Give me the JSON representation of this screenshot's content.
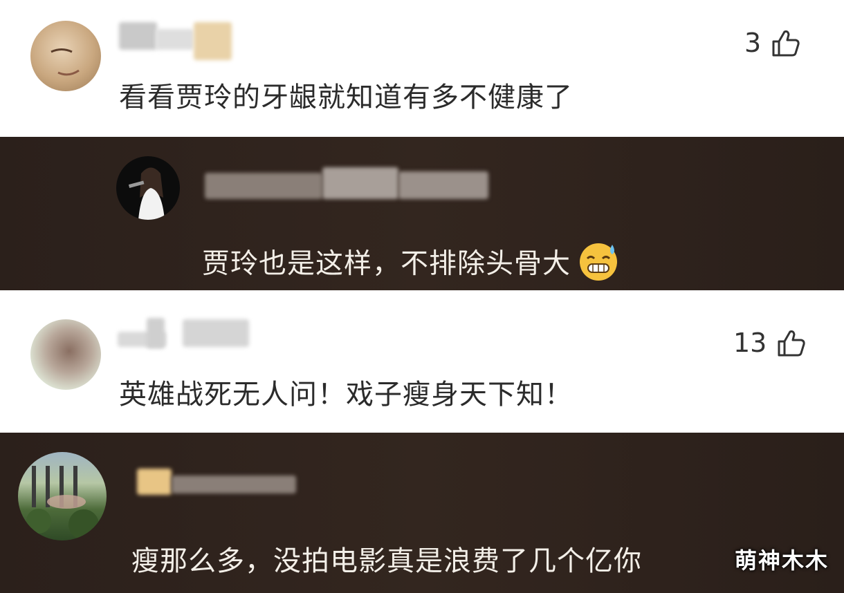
{
  "comments": [
    {
      "text": "看看贾玲的牙龈就知道有多不健康了",
      "likes": "3"
    },
    {
      "text": "贾玲也是这样，不排除头骨大",
      "emoji": "grinning-sweat-emoji"
    },
    {
      "text": "英雄战死无人问！戏子瘦身天下知！",
      "likes": "13"
    },
    {
      "text": "瘦那么多，没拍电影真是浪费了几个亿你"
    }
  ],
  "watermark": "萌神木木",
  "icons": {
    "like": "thumbs-up-icon"
  },
  "colors": {
    "dark_bg": "#2f231d",
    "light_bg": "#ffffff",
    "light_text": "#2b2b2b",
    "dark_text": "#f3efe8"
  }
}
